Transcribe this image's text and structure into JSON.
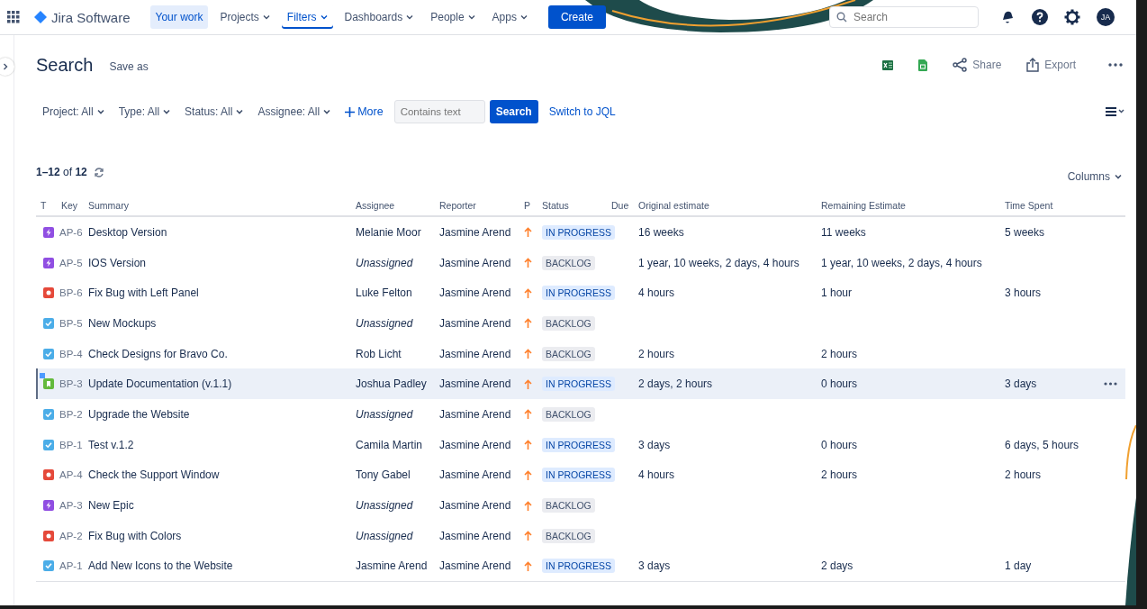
{
  "topbar": {
    "product": "Jira Software",
    "nav": [
      {
        "label": "Your work",
        "selected": false,
        "dropdown": false,
        "highlighted": true
      },
      {
        "label": "Projects",
        "selected": false,
        "dropdown": true,
        "highlighted": false
      },
      {
        "label": "Filters",
        "selected": true,
        "dropdown": true,
        "highlighted": false
      },
      {
        "label": "Dashboards",
        "selected": false,
        "dropdown": true,
        "highlighted": false
      },
      {
        "label": "People",
        "selected": false,
        "dropdown": true,
        "highlighted": false
      },
      {
        "label": "Apps",
        "selected": false,
        "dropdown": true,
        "highlighted": false
      }
    ],
    "create": "Create",
    "search": {
      "placeholder": "Search"
    },
    "avatar": "JA"
  },
  "page": {
    "title": "Search",
    "save_as": "Save as",
    "share": "Share",
    "export": "Export"
  },
  "filters": [
    {
      "label": "Project: All"
    },
    {
      "label": "Type: All"
    },
    {
      "label": "Status: All"
    },
    {
      "label": "Assignee: All"
    }
  ],
  "more": "More",
  "text_filter": {
    "placeholder": "Contains text"
  },
  "search_button": "Search",
  "switch_jql": "Switch to JQL",
  "results": {
    "range": "1–12",
    "of": "of",
    "total": "12"
  },
  "columns_button": "Columns",
  "table": {
    "columns": [
      "T",
      "Key",
      "Summary",
      "Assignee",
      "Reporter",
      "P",
      "Status",
      "Due",
      "Original estimate",
      "Remaining Estimate",
      "Time Spent"
    ],
    "rows": [
      {
        "kind": "epic",
        "key": "AP-6",
        "summary": "Desktop Version",
        "assignee": "Melanie Moor",
        "unassigned": false,
        "reporter": "Jasmine Arend",
        "status": {
          "label": "IN PROGRESS",
          "kind": "progress"
        },
        "original": "16 weeks",
        "remaining": "11 weeks",
        "spent": "5 weeks",
        "selected": false
      },
      {
        "kind": "epic",
        "key": "AP-5",
        "summary": "IOS Version",
        "assignee": "Unassigned",
        "unassigned": true,
        "reporter": "Jasmine Arend",
        "status": {
          "label": "BACKLOG",
          "kind": "backlog"
        },
        "original": "1 year, 10 weeks, 2 days, 4 hours",
        "remaining": "1 year, 10 weeks, 2 days, 4 hours",
        "selected": false
      },
      {
        "kind": "bug",
        "key": "BP-6",
        "summary": "Fix Bug with Left Panel",
        "assignee": "Luke Felton",
        "unassigned": false,
        "reporter": "Jasmine Arend",
        "status": {
          "label": "IN PROGRESS",
          "kind": "progress"
        },
        "original": "4 hours",
        "remaining": "1 hour",
        "spent": "3 hours",
        "selected": false
      },
      {
        "kind": "task",
        "key": "BP-5",
        "summary": "New Mockups",
        "assignee": "Unassigned",
        "unassigned": true,
        "reporter": "Jasmine Arend",
        "status": {
          "label": "BACKLOG",
          "kind": "backlog"
        },
        "selected": false
      },
      {
        "kind": "task",
        "key": "BP-4",
        "summary": "Check Designs for Bravo Co.",
        "assignee": "Rob Licht",
        "unassigned": false,
        "reporter": "Jasmine Arend",
        "status": {
          "label": "BACKLOG",
          "kind": "backlog"
        },
        "original": "2 hours",
        "remaining": "2 hours",
        "selected": false
      },
      {
        "kind": "story",
        "key": "BP-3",
        "summary": "Update Documentation (v.1.1)",
        "assignee": "Joshua Padley",
        "unassigned": false,
        "reporter": "Jasmine Arend",
        "status": {
          "label": "IN PROGRESS",
          "kind": "progress"
        },
        "original": "2 days, 2 hours",
        "remaining": "0 hours",
        "spent": "3 days",
        "selected": true
      },
      {
        "kind": "task",
        "key": "BP-2",
        "summary": "Upgrade the Website",
        "assignee": "Unassigned",
        "unassigned": true,
        "reporter": "Jasmine Arend",
        "status": {
          "label": "BACKLOG",
          "kind": "backlog"
        },
        "selected": false
      },
      {
        "kind": "task",
        "key": "BP-1",
        "summary": "Test v.1.2",
        "assignee": "Camila Martin",
        "unassigned": false,
        "reporter": "Jasmine Arend",
        "status": {
          "label": "IN PROGRESS",
          "kind": "progress"
        },
        "original": "3 days",
        "remaining": "0 hours",
        "spent": "6 days, 5 hours",
        "selected": false
      },
      {
        "kind": "bug",
        "key": "AP-4",
        "summary": "Check the Support Window",
        "assignee": "Tony Gabel",
        "unassigned": false,
        "reporter": "Jasmine Arend",
        "status": {
          "label": "IN PROGRESS",
          "kind": "progress"
        },
        "original": "4 hours",
        "remaining": "2 hours",
        "spent": "2 hours",
        "selected": false
      },
      {
        "kind": "epic",
        "key": "AP-3",
        "summary": "New Epic",
        "assignee": "Unassigned",
        "unassigned": true,
        "reporter": "Jasmine Arend",
        "status": {
          "label": "BACKLOG",
          "kind": "backlog"
        },
        "selected": false
      },
      {
        "kind": "bug",
        "key": "AP-2",
        "summary": "Fix Bug with Colors",
        "assignee": "Unassigned",
        "unassigned": true,
        "reporter": "Jasmine Arend",
        "status": {
          "label": "BACKLOG",
          "kind": "backlog"
        },
        "selected": false
      },
      {
        "kind": "task",
        "key": "AP-1",
        "summary": "Add New Icons to the Website",
        "assignee": "Jasmine Arend",
        "unassigned": false,
        "reporter": "Jasmine Arend",
        "status": {
          "label": "IN PROGRESS",
          "kind": "progress"
        },
        "original": "3 days",
        "remaining": "2 days",
        "spent": "1 day",
        "selected": false
      }
    ]
  }
}
